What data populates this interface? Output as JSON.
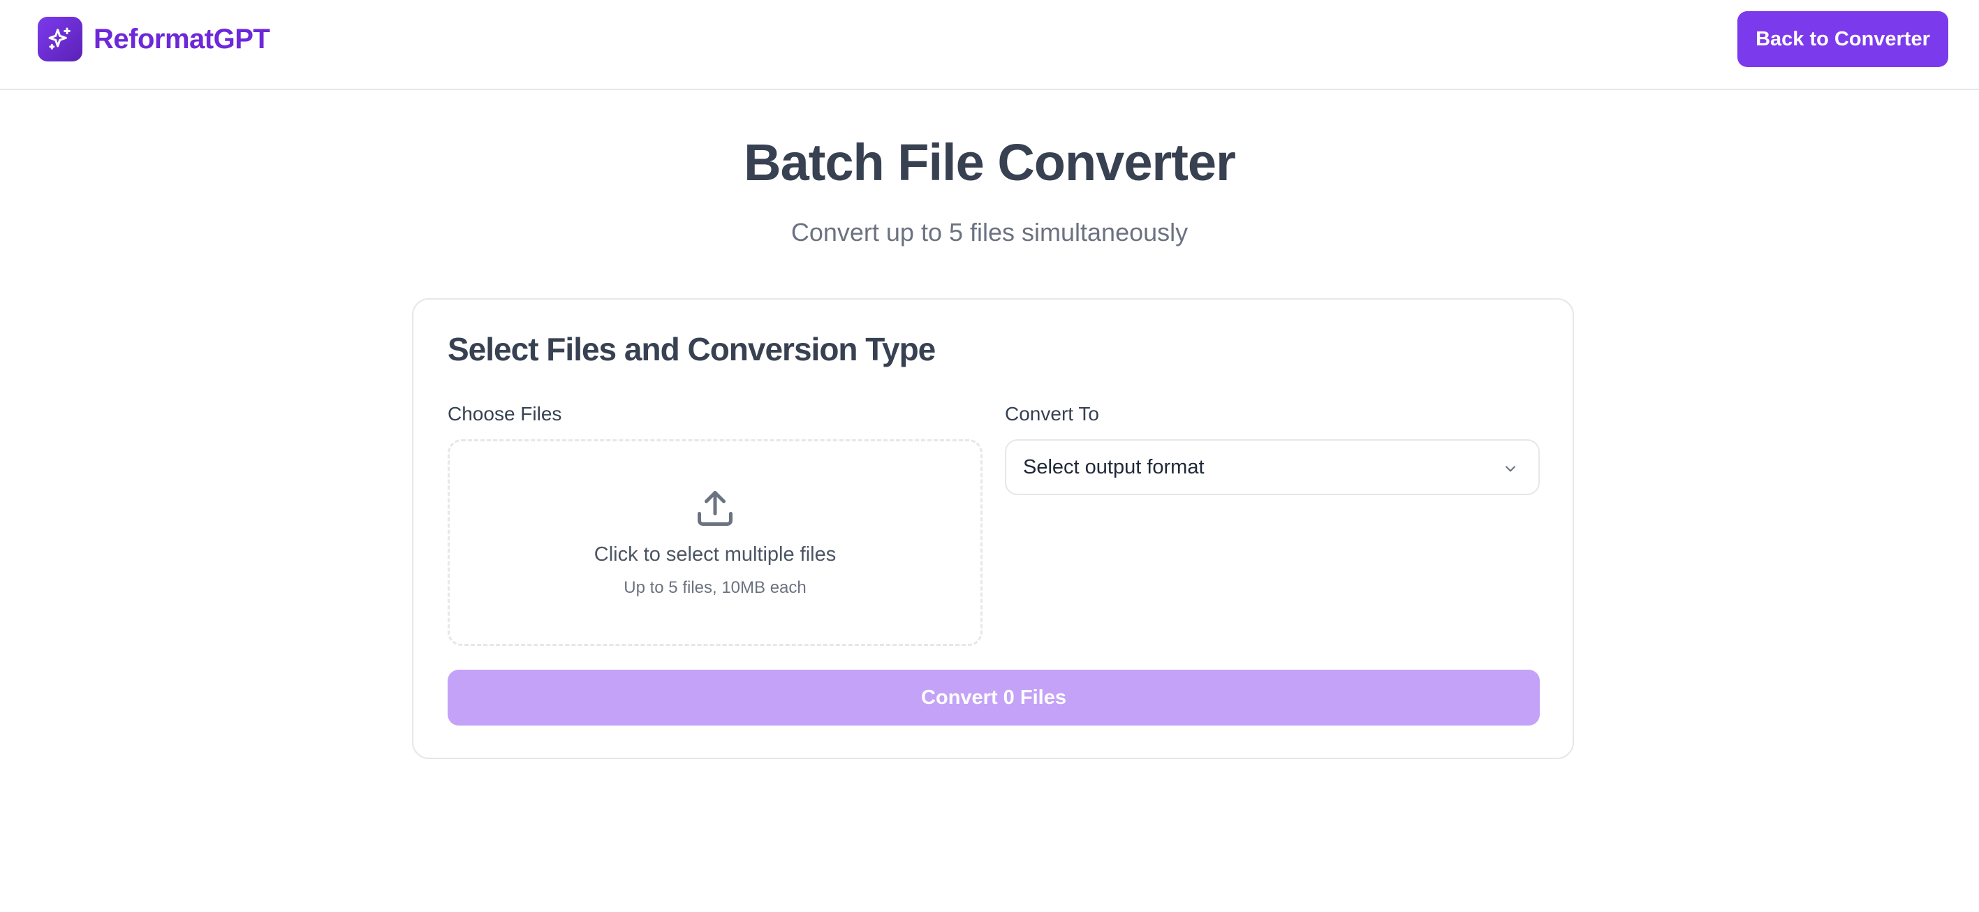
{
  "header": {
    "logo_text": "ReformatGPT",
    "logo_icon": "sparkles-icon",
    "back_button_label": "Back to Converter"
  },
  "hero": {
    "title": "Batch File Converter",
    "subtitle": "Convert up to 5 files simultaneously"
  },
  "card": {
    "title": "Select Files and Conversion Type",
    "files_label": "Choose Files",
    "dropzone": {
      "icon": "upload-icon",
      "primary_text": "Click to select multiple files",
      "secondary_text": "Up to 5 files, 10MB each"
    },
    "convert_to_label": "Convert To",
    "format_select": {
      "selected_value": "Select output format",
      "icon": "chevron-down-icon"
    },
    "convert_button_label": "Convert 0 Files"
  },
  "colors": {
    "brand": "#7c3aed",
    "brand_text": "#6d28d9",
    "button_disabled": "#c4a2f7",
    "heading": "#374151",
    "muted": "#6b7280",
    "border": "#e5e7eb"
  }
}
